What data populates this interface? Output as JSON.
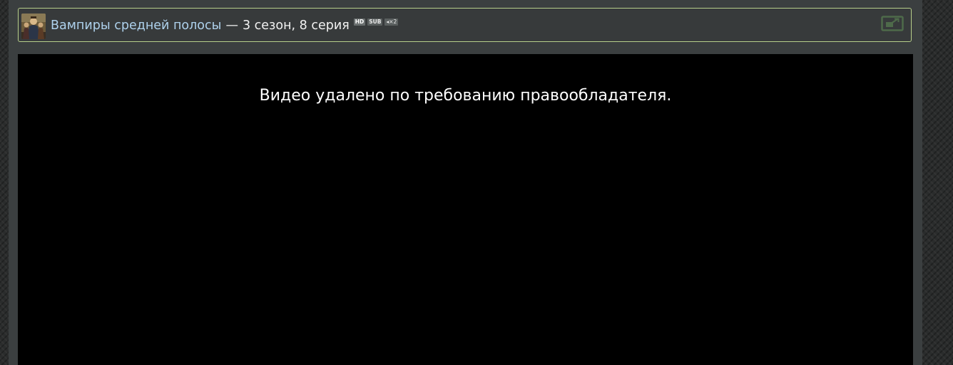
{
  "header": {
    "poster_icon": "show-poster-thumbnail",
    "show_title": "Вампиры средней полосы",
    "separator": "—",
    "episode": "3 сезон, 8 серия",
    "badges": {
      "hd": "HD",
      "sub": "SUB",
      "sound": "◂×2"
    },
    "expand_icon": "expand-window-icon"
  },
  "player": {
    "message": "Видео удалено по требованию правообладателя."
  },
  "colors": {
    "page_background": "#2a2c2c",
    "panel": "#3b3f40",
    "header_border": "#b7cf8a",
    "link": "#aed1ec",
    "text": "#f2f2f2",
    "video_background": "#000000",
    "icon": "#4e6a4a"
  }
}
